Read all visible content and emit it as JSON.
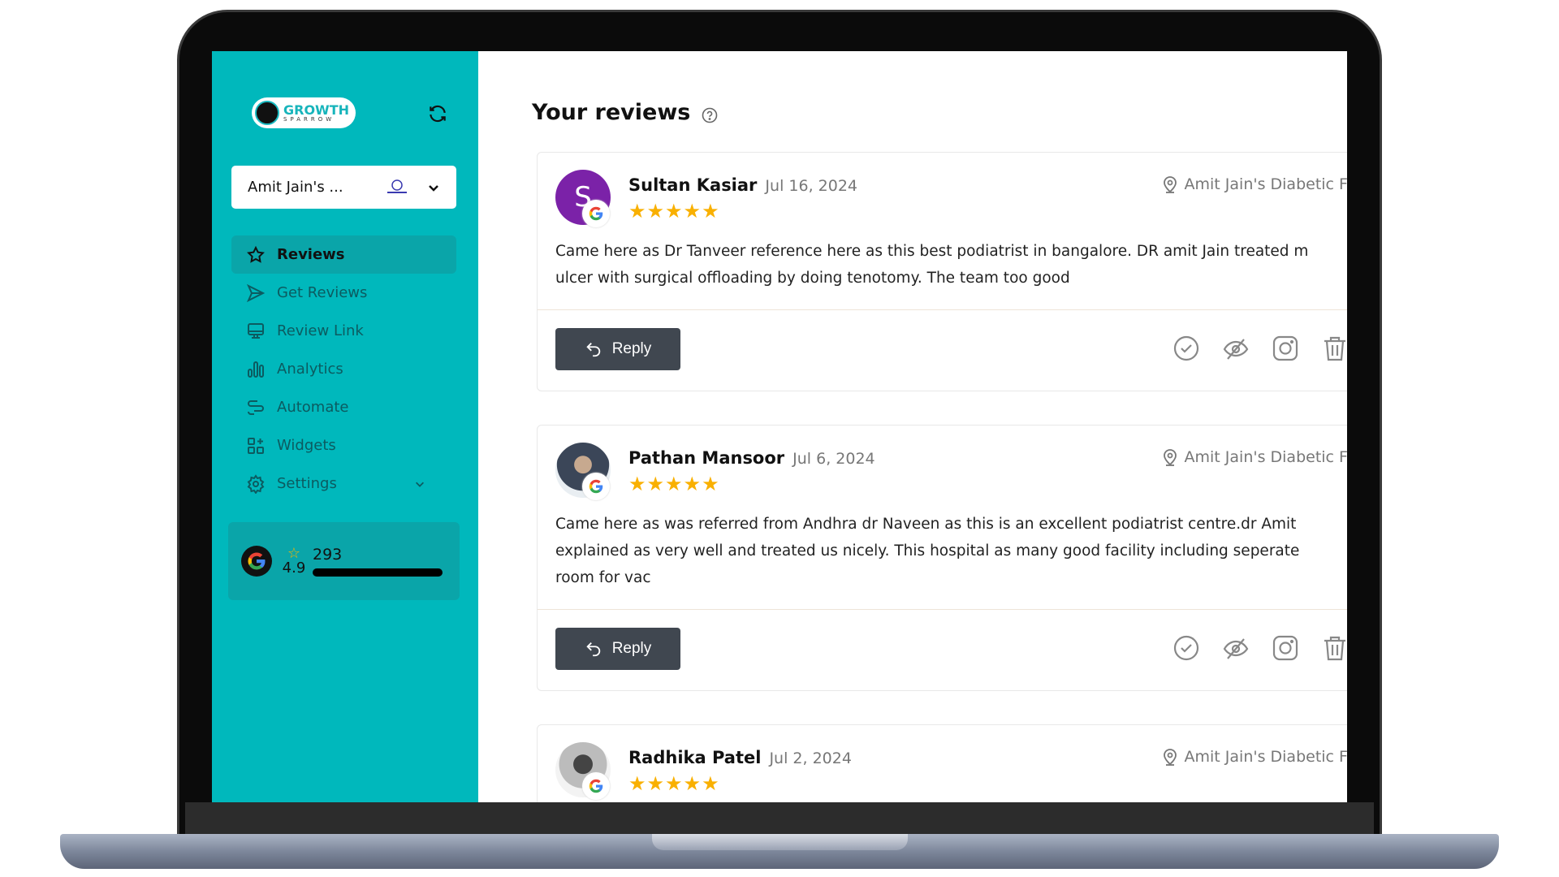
{
  "brand": {
    "name": "GROWTH",
    "sub": "SPARROW",
    "accent": "#00b8bc"
  },
  "location_select": {
    "value": "Amit Jain's ..."
  },
  "nav": [
    {
      "label": "Reviews",
      "icon": "star-icon",
      "active": true
    },
    {
      "label": "Get Reviews",
      "icon": "send-icon"
    },
    {
      "label": "Review Link",
      "icon": "monitor-icon"
    },
    {
      "label": "Analytics",
      "icon": "bar-chart-icon"
    },
    {
      "label": "Automate",
      "icon": "automate-icon"
    },
    {
      "label": "Widgets",
      "icon": "widgets-icon"
    },
    {
      "label": "Settings",
      "icon": "gear-icon"
    }
  ],
  "rating": {
    "score": "4.9",
    "count": "293"
  },
  "main": {
    "title": "Your reviews",
    "reply_label": "Reply"
  },
  "reviews": [
    {
      "name": "Sultan Kasiar",
      "date": "Jul 16, 2024",
      "stars": 5,
      "initial": "S",
      "location": "Amit Jain's Diabetic Foot",
      "lines": [
        "Came here as Dr Tanveer reference here as this best podiatrist in bangalore. DR amit Jain treated m",
        "ulcer with surgical offloading by doing tenotomy. The team too good"
      ]
    },
    {
      "name": "Pathan Mansoor",
      "date": "Jul 6, 2024",
      "stars": 5,
      "location": "Amit Jain's Diabetic Foot",
      "lines": [
        "Came here as was referred from Andhra dr Naveen as this is an excellent podiatrist centre.dr Amit",
        "explained as very well and treated us nicely. This hospital as many good facility including seperate",
        "room for vac"
      ]
    },
    {
      "name": "Radhika Patel",
      "date": "Jul 2, 2024",
      "stars": 5,
      "location": "Amit Jain's Diabetic Foot",
      "lines": []
    }
  ]
}
